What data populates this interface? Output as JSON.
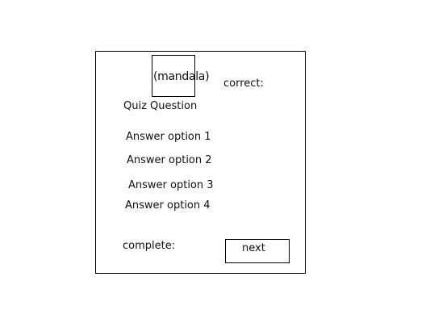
{
  "quiz": {
    "image_label": "(mandala)",
    "correct_label": "correct:",
    "question": "Quiz Question",
    "answers": [
      "Answer option 1",
      "Answer option 2",
      "Answer option 3",
      "Answer option 4"
    ],
    "complete_label": "complete:",
    "next_label": "next"
  }
}
